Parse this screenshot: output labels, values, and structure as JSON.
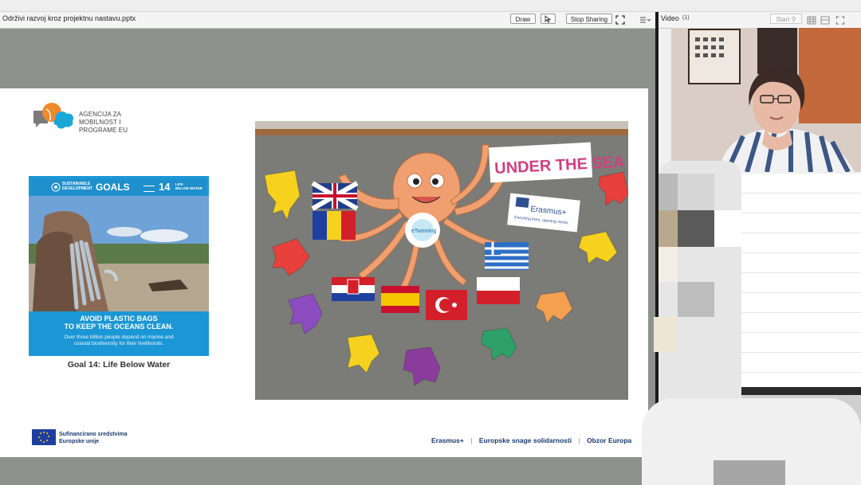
{
  "presentation": {
    "title": "Održivi razvoj kroz projektnu nastavu.pptx",
    "draw_label": "Draw",
    "stop_sharing_label": "Stop Sharing"
  },
  "video": {
    "title": "Video",
    "count": "(1)",
    "start_label": "Start"
  },
  "slide": {
    "org_line1": "AGENCIJA ZA",
    "org_line2": "MOBILNOST I",
    "org_line3": "PROGRAME EU",
    "sdg_heading": "GOALS",
    "sdg_heading_small1": "SUSTAINABLE",
    "sdg_heading_small2": "DEVELOPMENT",
    "sdg_number": "14",
    "sdg_number_label1": "LIFE",
    "sdg_number_label2": "BELOW WATER",
    "card_headline1": "AVOID PLASTIC BAGS",
    "card_headline2": "TO KEEP THE OCEANS CLEAN.",
    "card_body1": "Over three billion people depend on marine and",
    "card_body2": "coastal biodiversity for their livelihoods.",
    "caption": "Goal 14: Life Below Water",
    "photo_banner": "UNDER THE SEA",
    "photo_erasmus": "Erasmus+",
    "photo_erasmus_tag": "Enriching lives, opening minds.",
    "photo_etwinning": "eTwinning",
    "eu_line1": "Sufinancirano sredstvima",
    "eu_line2": "Europske unije",
    "footer_link1": "Erasmus+",
    "footer_link2": "Europske snage solidarnosti",
    "footer_link3": "Obzor Europa"
  },
  "colors": {
    "slide_bg": "#ffffff",
    "pres_bg": "#8d928c",
    "sdg_blue": "#1c97d6",
    "octopus": "#f0a070",
    "footer_text": "#1a3a6e"
  }
}
